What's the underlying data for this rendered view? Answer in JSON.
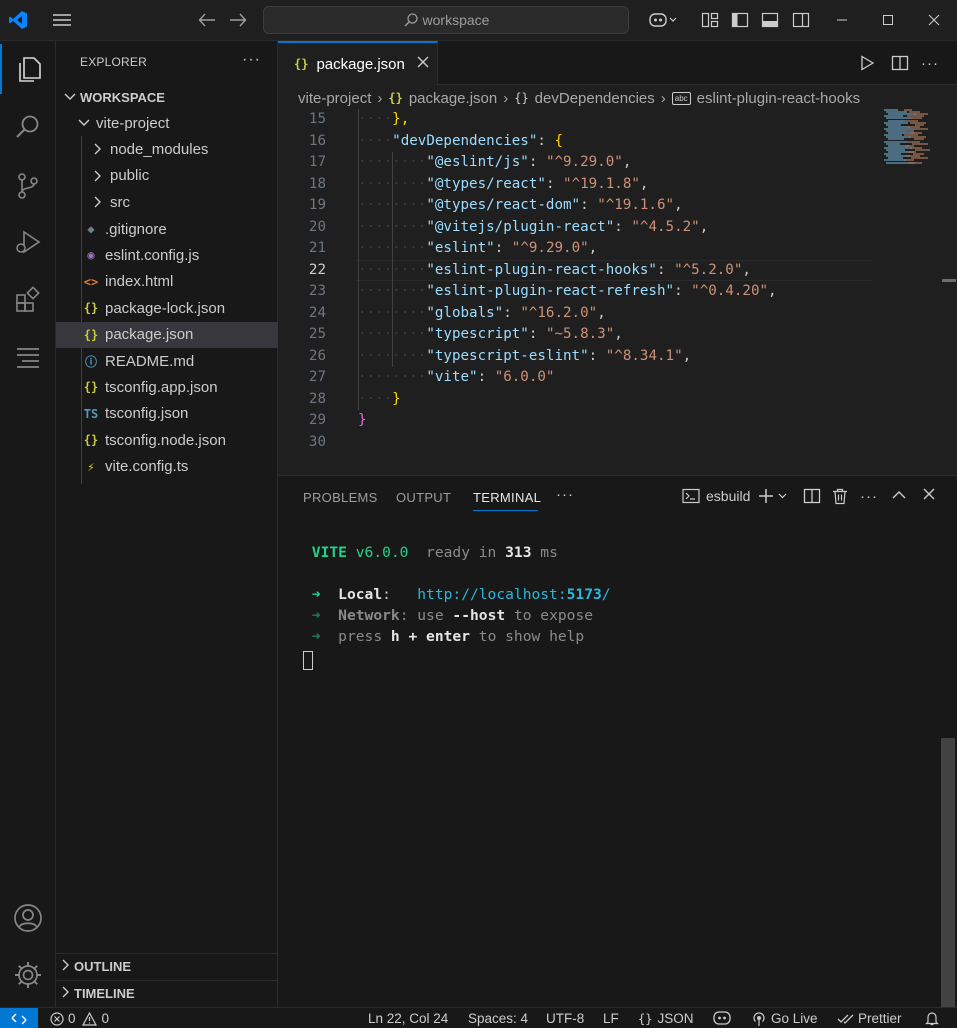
{
  "titlebar": {
    "search_placeholder": "workspace",
    "icons": [
      "vscode-logo-icon",
      "menu-icon",
      "back-arrow-icon",
      "forward-arrow-icon",
      "copilot-icon",
      "customize-layout-icon",
      "toggle-sidebar-icon",
      "toggle-panel-icon",
      "toggle-secondary-sidebar-icon",
      "minimize-icon",
      "maximize-icon",
      "close-icon"
    ]
  },
  "activitybar": {
    "items": [
      "explorer-icon",
      "search-icon",
      "source-control-icon",
      "run-debug-icon",
      "extensions-icon",
      "outline-icon"
    ],
    "bottom": [
      "accounts-icon",
      "manage-gear-icon"
    ]
  },
  "sidebar": {
    "title": "EXPLORER",
    "more": "···",
    "workspace_label": "WORKSPACE",
    "project": "vite-project",
    "folders": [
      {
        "name": "node_modules"
      },
      {
        "name": "public"
      },
      {
        "name": "src"
      }
    ],
    "files": [
      {
        "name": ".gitignore",
        "icon": "◆",
        "color": "#6d8086"
      },
      {
        "name": "eslint.config.js",
        "icon": "◉",
        "color": "#a074c4"
      },
      {
        "name": "index.html",
        "icon": "<>",
        "color": "#e37933"
      },
      {
        "name": "package-lock.json",
        "icon": "{}",
        "color": "#cbcb41"
      },
      {
        "name": "package.json",
        "icon": "{}",
        "color": "#cbcb41",
        "selected": true
      },
      {
        "name": "README.md",
        "icon": "ⓘ",
        "color": "#519aba"
      },
      {
        "name": "tsconfig.app.json",
        "icon": "{}",
        "color": "#cbcb41"
      },
      {
        "name": "tsconfig.json",
        "icon": "TS",
        "color": "#519aba"
      },
      {
        "name": "tsconfig.node.json",
        "icon": "{}",
        "color": "#cbcb41"
      },
      {
        "name": "vite.config.ts",
        "icon": "⚡",
        "color": "#ffd700"
      }
    ],
    "outline_label": "OUTLINE",
    "timeline_label": "TIMELINE"
  },
  "editor": {
    "tab_label": "package.json",
    "tab_icon": "{}",
    "breadcrumb": {
      "project": "vite-project",
      "file": "package.json",
      "section": "devDependencies",
      "key": "eslint-plugin-react-hooks",
      "key_icon": "abc"
    },
    "current_line": 22,
    "lines": [
      {
        "n": "15",
        "indent": 1,
        "parts": [
          [
            "b2",
            "},"
          ]
        ]
      },
      {
        "n": "16",
        "indent": 1,
        "parts": [
          [
            "k",
            "\"devDependencies\""
          ],
          [
            "p",
            ": "
          ],
          [
            "b2",
            "{"
          ]
        ]
      },
      {
        "n": "17",
        "indent": 2,
        "parts": [
          [
            "k",
            "\"@eslint/js\""
          ],
          [
            "p",
            ": "
          ],
          [
            "s",
            "\"^9.29.0\""
          ],
          [
            "p",
            ","
          ]
        ]
      },
      {
        "n": "18",
        "indent": 2,
        "parts": [
          [
            "k",
            "\"@types/react\""
          ],
          [
            "p",
            ": "
          ],
          [
            "s",
            "\"^19.1.8\""
          ],
          [
            "p",
            ","
          ]
        ]
      },
      {
        "n": "19",
        "indent": 2,
        "parts": [
          [
            "k",
            "\"@types/react-dom\""
          ],
          [
            "p",
            ": "
          ],
          [
            "s",
            "\"^19.1.6\""
          ],
          [
            "p",
            ","
          ]
        ]
      },
      {
        "n": "20",
        "indent": 2,
        "parts": [
          [
            "k",
            "\"@vitejs/plugin-react\""
          ],
          [
            "p",
            ": "
          ],
          [
            "s",
            "\"^4.5.2\""
          ],
          [
            "p",
            ","
          ]
        ]
      },
      {
        "n": "21",
        "indent": 2,
        "parts": [
          [
            "k",
            "\"eslint\""
          ],
          [
            "p",
            ": "
          ],
          [
            "s",
            "\"^9.29.0\""
          ],
          [
            "p",
            ","
          ]
        ]
      },
      {
        "n": "22",
        "indent": 2,
        "parts": [
          [
            "k",
            "\"eslint-plugin-react-hooks\""
          ],
          [
            "p",
            ": "
          ],
          [
            "s",
            "\"^5.2.0\""
          ],
          [
            "p",
            ","
          ]
        ]
      },
      {
        "n": "23",
        "indent": 2,
        "parts": [
          [
            "k",
            "\"eslint-plugin-react-refresh\""
          ],
          [
            "p",
            ": "
          ],
          [
            "s",
            "\"^0.4.20\""
          ],
          [
            "p",
            ","
          ]
        ]
      },
      {
        "n": "24",
        "indent": 2,
        "parts": [
          [
            "k",
            "\"globals\""
          ],
          [
            "p",
            ": "
          ],
          [
            "s",
            "\"^16.2.0\""
          ],
          [
            "p",
            ","
          ]
        ]
      },
      {
        "n": "25",
        "indent": 2,
        "parts": [
          [
            "k",
            "\"typescript\""
          ],
          [
            "p",
            ": "
          ],
          [
            "s",
            "\"~5.8.3\""
          ],
          [
            "p",
            ","
          ]
        ]
      },
      {
        "n": "26",
        "indent": 2,
        "parts": [
          [
            "k",
            "\"typescript-eslint\""
          ],
          [
            "p",
            ": "
          ],
          [
            "s",
            "\"^8.34.1\""
          ],
          [
            "p",
            ","
          ]
        ]
      },
      {
        "n": "27",
        "indent": 2,
        "parts": [
          [
            "k",
            "\"vite\""
          ],
          [
            "p",
            ": "
          ],
          [
            "s",
            "\"6.0.0\""
          ]
        ]
      },
      {
        "n": "28",
        "indent": 1,
        "parts": [
          [
            "b2",
            "}"
          ]
        ]
      },
      {
        "n": "29",
        "indent": 0,
        "parts": [
          [
            "b1",
            "}"
          ]
        ]
      },
      {
        "n": "30",
        "indent": 0,
        "parts": []
      }
    ]
  },
  "panel": {
    "tabs": [
      "PROBLEMS",
      "OUTPUT",
      "TERMINAL"
    ],
    "active_tab": "TERMINAL",
    "more": "···",
    "terminal_name": "esbuild",
    "terminal": {
      "vite_label": "VITE",
      "vite_version": "v6.0.0",
      "ready_text": "ready in",
      "ready_ms": "313",
      "ms": "ms",
      "arrow": "➜",
      "local_label": "Local",
      "local_url": "http://localhost:",
      "local_port": "5173",
      "local_slash": "/",
      "network_label": "Network",
      "network_text1": "use",
      "network_flag": "--host",
      "network_text2": "to expose",
      "press_text": "press",
      "press_key": "h + enter",
      "press_text2": "to show help"
    }
  },
  "statusbar": {
    "errors": "0",
    "warnings": "0",
    "position": "Ln 22, Col 24",
    "spaces": "Spaces: 4",
    "encoding": "UTF-8",
    "eol": "LF",
    "language": "JSON",
    "golive": "Go Live",
    "prettier": "Prettier"
  },
  "colors": {
    "accent": "#0078d4",
    "json_icon": "#cbcb41"
  }
}
